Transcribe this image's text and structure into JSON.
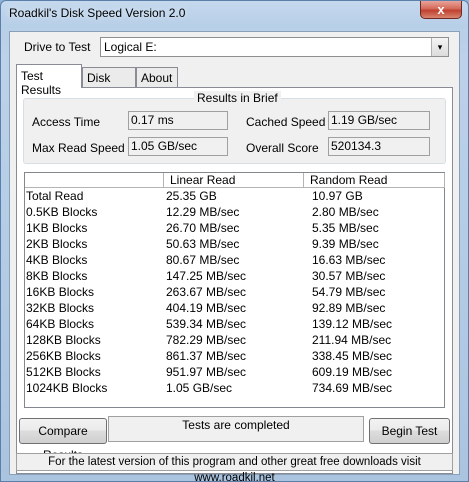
{
  "window": {
    "title": "Roadkil's Disk Speed Version 2.0",
    "close_glyph": "x"
  },
  "drive": {
    "label": "Drive to Test",
    "selected": "Logical E:",
    "arrow_glyph": "▾"
  },
  "tabs": [
    {
      "label": "Test Results",
      "active": true
    },
    {
      "label": "Disk Info",
      "active": false
    },
    {
      "label": "About",
      "active": false
    }
  ],
  "brief": {
    "title": "Results in Brief",
    "access_time_label": "Access Time",
    "access_time": "0.17 ms",
    "cached_speed_label": "Cached Speed",
    "cached_speed": "1.19 GB/sec",
    "max_read_label": "Max Read Speed",
    "max_read": "1.05 GB/sec",
    "overall_label": "Overall Score",
    "overall": "520134.3"
  },
  "results": {
    "columns": [
      "",
      "Linear Read",
      "Random Read"
    ],
    "rows": [
      [
        "Total Read",
        "25.35 GB",
        "10.97 GB"
      ],
      [
        "0.5KB Blocks",
        "12.29 MB/sec",
        "2.80 MB/sec"
      ],
      [
        "1KB Blocks",
        "26.70 MB/sec",
        "5.35 MB/sec"
      ],
      [
        "2KB Blocks",
        "50.63 MB/sec",
        "9.39 MB/sec"
      ],
      [
        "4KB Blocks",
        "80.67 MB/sec",
        "16.63 MB/sec"
      ],
      [
        "8KB Blocks",
        "147.25 MB/sec",
        "30.57 MB/sec"
      ],
      [
        "16KB Blocks",
        "263.67 MB/sec",
        "54.79 MB/sec"
      ],
      [
        "32KB Blocks",
        "404.19 MB/sec",
        "92.89 MB/sec"
      ],
      [
        "64KB Blocks",
        "539.34 MB/sec",
        "139.12 MB/sec"
      ],
      [
        "128KB Blocks",
        "782.29 MB/sec",
        "211.94 MB/sec"
      ],
      [
        "256KB Blocks",
        "861.37 MB/sec",
        "338.45 MB/sec"
      ],
      [
        "512KB Blocks",
        "951.97 MB/sec",
        "609.19 MB/sec"
      ],
      [
        "1024KB Blocks",
        "1.05 GB/sec",
        "734.69 MB/sec"
      ]
    ]
  },
  "buttons": {
    "compare": "Compare Results",
    "begin": "Begin Test"
  },
  "status": "Tests are completed",
  "footer": "For the latest version of this program and other great free downloads visit www.roadkil.net"
}
